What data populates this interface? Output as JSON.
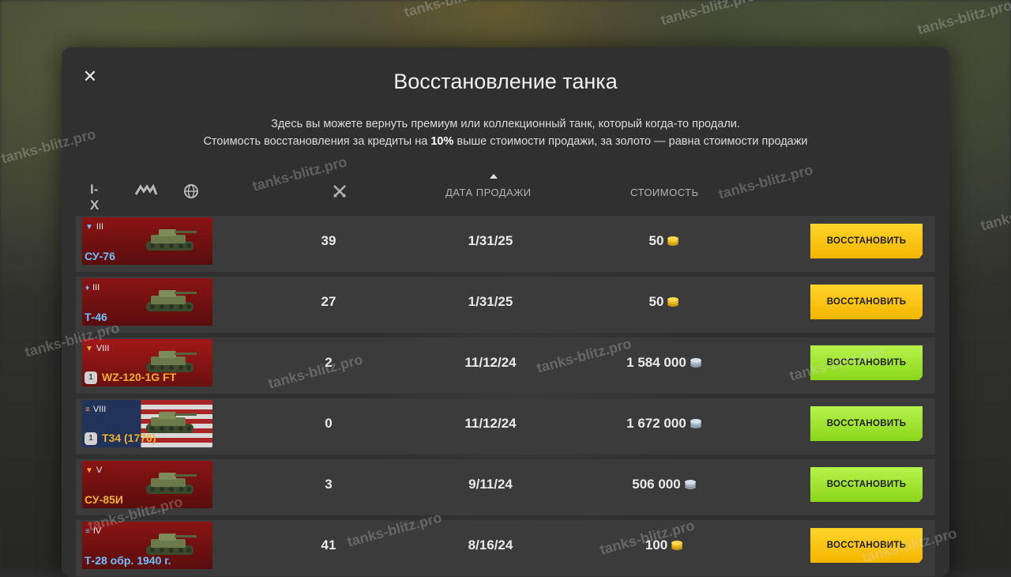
{
  "dialog": {
    "title": "Восстановление танка",
    "desc_line1": "Здесь вы можете вернуть премиум или коллекционный танк, который когда-то продали.",
    "desc_line2_a": "Стоимость восстановления за кредиты на ",
    "desc_line2_b": "10%",
    "desc_line2_c": " выше стоимости продажи, за золото — равна стоимости продажи"
  },
  "filters": {
    "tier": "I-X"
  },
  "columns": {
    "date": "ДАТА ПРОДАЖИ",
    "cost": "СТОИМОСТЬ"
  },
  "rows": [
    {
      "tier": "III",
      "tier_icon": "▼",
      "name": "СУ-76",
      "name_color": "blue",
      "nation": "ussr",
      "mastery": "",
      "battles": "39",
      "date": "1/31/25",
      "cost": "50",
      "currency": "gold",
      "button": "ВОССТАНОВИТЬ"
    },
    {
      "tier": "III",
      "tier_icon": "♦",
      "name": "Т-46",
      "name_color": "blue",
      "nation": "ussr",
      "mastery": "",
      "battles": "27",
      "date": "1/31/25",
      "cost": "50",
      "currency": "gold",
      "button": "ВОССТАНОВИТЬ"
    },
    {
      "tier": "VIII",
      "tier_icon": "▼",
      "name": "WZ-120-1G FT",
      "name_color": "gold",
      "nation": "china",
      "mastery": "1",
      "battles": "2",
      "date": "11/12/24",
      "cost": "1 584 000",
      "currency": "silver",
      "button": "ВОССТАНОВИТЬ"
    },
    {
      "tier": "VIII",
      "tier_icon": "≡",
      "name": "T34 (1776)",
      "name_color": "gold",
      "nation": "usa",
      "mastery": "1",
      "battles": "0",
      "date": "11/12/24",
      "cost": "1 672 000",
      "currency": "silver",
      "button": "ВОССТАНОВИТЬ"
    },
    {
      "tier": "V",
      "tier_icon": "▼",
      "name": "СУ-85И",
      "name_color": "gold",
      "nation": "ussr",
      "mastery": "",
      "battles": "3",
      "date": "9/11/24",
      "cost": "506 000",
      "currency": "silver",
      "button": "ВОССТАНОВИТЬ"
    },
    {
      "tier": "IV",
      "tier_icon": "≡",
      "name": "Т-28 обр. 1940 г.",
      "name_color": "blue",
      "nation": "ussr",
      "mastery": "",
      "battles": "41",
      "date": "8/16/24",
      "cost": "100",
      "currency": "gold",
      "button": "ВОССТАНОВИТЬ"
    }
  ],
  "watermark": "tanks-blitz.pro",
  "colors": {
    "gold_button": "#ffd42a",
    "silver_button": "#b6f34a",
    "blue_name": "#6fc0ff",
    "gold_name": "#f0b030"
  },
  "icons": {
    "close": "close-icon",
    "type_filter": "tank-type-icon",
    "nation_filter": "globe-icon",
    "battles_column": "crossed-swords-icon",
    "gold": "gold-coin-icon",
    "silver": "silver-coin-icon"
  }
}
